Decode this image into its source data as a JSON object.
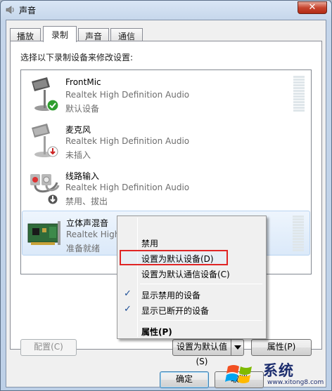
{
  "window": {
    "title": "声音",
    "close_label": "✕"
  },
  "tabs": [
    {
      "label": "播放",
      "active": false
    },
    {
      "label": "录制",
      "active": true
    },
    {
      "label": "声音",
      "active": false
    },
    {
      "label": "通信",
      "active": false
    }
  ],
  "recording": {
    "instruction": "选择以下录制设备来修改设置:",
    "devices": [
      {
        "name": "FrontMic",
        "driver": "Realtek High Definition Audio",
        "status": "默认设备",
        "icon": "microphone-icon",
        "badge": "default-check-badge"
      },
      {
        "name": "麦克风",
        "driver": "Realtek High Definition Audio",
        "status": "未插入",
        "icon": "microphone-icon",
        "badge": "unplugged-badge"
      },
      {
        "name": "线路输入",
        "driver": "Realtek High Definition Audio",
        "status": "禁用、拔出",
        "icon": "line-in-jack-icon",
        "badge": "disabled-badge"
      },
      {
        "name": "立体声混音",
        "driver": "Realtek High Definition Audio",
        "status": "准备就绪",
        "icon": "sound-card-icon",
        "badge": ""
      }
    ]
  },
  "context_menu": {
    "items": [
      {
        "label": "禁用",
        "checked": false
      },
      {
        "label": "设置为默认设备(D)",
        "checked": false,
        "highlighted": true
      },
      {
        "label": "设置为默认通信设备(C)",
        "checked": false
      },
      {
        "label": "显示禁用的设备",
        "checked": true
      },
      {
        "label": "显示已断开的设备",
        "checked": true
      },
      {
        "label": "属性(P)",
        "checked": false,
        "bold": true
      }
    ],
    "check_glyph": "✓"
  },
  "buttons": {
    "configure": "配置(C)",
    "set_default": "设置为默认值(S)",
    "properties": "属性(P)",
    "ok": "确定",
    "cancel": "取消"
  },
  "watermark": {
    "text": "系统",
    "url": "www.xitong8.com"
  },
  "colors": {
    "highlight_border": "#e02525",
    "selection_fill": "#dbe9f9",
    "check": "#1c4e96"
  }
}
